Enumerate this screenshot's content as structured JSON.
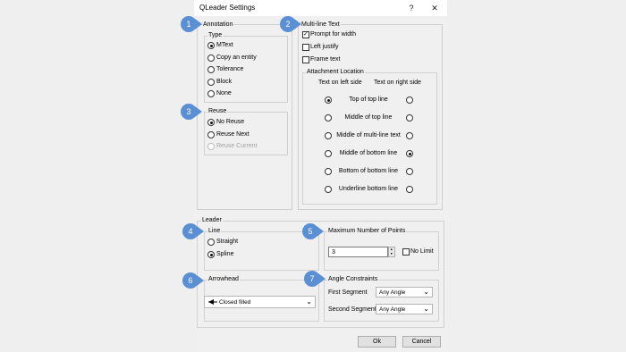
{
  "window": {
    "title": "QLeader Settings",
    "help_label": "?",
    "close_label": "✕"
  },
  "badges": [
    "1",
    "2",
    "3",
    "4",
    "5",
    "6",
    "7"
  ],
  "annotation": {
    "label": "Annotation",
    "type_label": "Type",
    "options": [
      "MText",
      "Copy an entity",
      "Tolerance",
      "Block",
      "None"
    ],
    "selected": "MText"
  },
  "reuse": {
    "label": "Reuse",
    "options": [
      "No Reuse",
      "Reuse Next",
      "Reuse Current"
    ],
    "selected": "No Reuse"
  },
  "multiline": {
    "label": "Multi-line Text",
    "checks": [
      {
        "label": "Prompt for width",
        "checked": true
      },
      {
        "label": "Left justify",
        "checked": false
      },
      {
        "label": "Frame text",
        "checked": false
      }
    ],
    "attachment": {
      "label": "Attachment Location",
      "left_header": "Text on left side",
      "right_header": "Text on right side",
      "rows": [
        "Top of top line",
        "Middle of top line",
        "Middle of multi-line text",
        "Middle of bottom line",
        "Bottom of bottom line",
        "Underline bottom line"
      ],
      "left_selected": "Top of top line",
      "right_selected": "Middle of bottom line"
    }
  },
  "leader": {
    "label": "Leader",
    "line_label": "Line",
    "line_options": [
      "Straight",
      "Spline"
    ],
    "line_selected": "Spline",
    "arrowhead_label": "Arrowhead",
    "arrowhead_value": "Closed filled",
    "arrowhead_chevron": "⌄"
  },
  "max_points": {
    "label": "Maximum Number of Points",
    "value": "3",
    "spin_up": "▲",
    "spin_down": "▼",
    "no_limit_label": "No Limit",
    "no_limit_checked": false
  },
  "angle": {
    "label": "Angle Constraints",
    "first_label": "First Segment",
    "first_value": "Any Angle",
    "second_label": "Second Segment",
    "second_value": "Any Angle",
    "chevron": "⌄"
  },
  "buttons": {
    "ok": "Ok",
    "cancel": "Cancel"
  }
}
